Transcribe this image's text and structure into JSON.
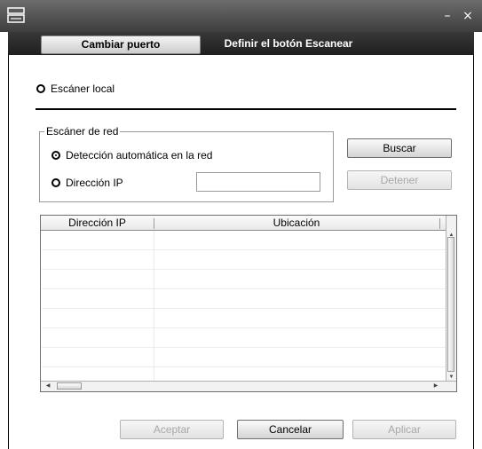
{
  "window": {
    "minimize_glyph": "–",
    "close_glyph": "×"
  },
  "tabs": [
    {
      "label": "Cambiar puerto",
      "active": true
    },
    {
      "label": "Definir el botón Escanear",
      "active": false
    }
  ],
  "local": {
    "label": "Escáner local",
    "checked": false
  },
  "network": {
    "group_title": "Escáner de red",
    "auto_label": "Detección automática en la red",
    "ip_label": "Dirección IP",
    "ip_value": "",
    "selected": "auto"
  },
  "buttons": {
    "search": "Buscar",
    "stop": "Detener",
    "accept": "Aceptar",
    "cancel": "Cancelar",
    "apply": "Aplicar"
  },
  "table": {
    "columns": [
      "Dirección IP",
      "Ubicación"
    ],
    "rows": []
  },
  "icons": {
    "app": "scanner-icon",
    "minimize": "minimize-icon",
    "close": "close-icon"
  }
}
